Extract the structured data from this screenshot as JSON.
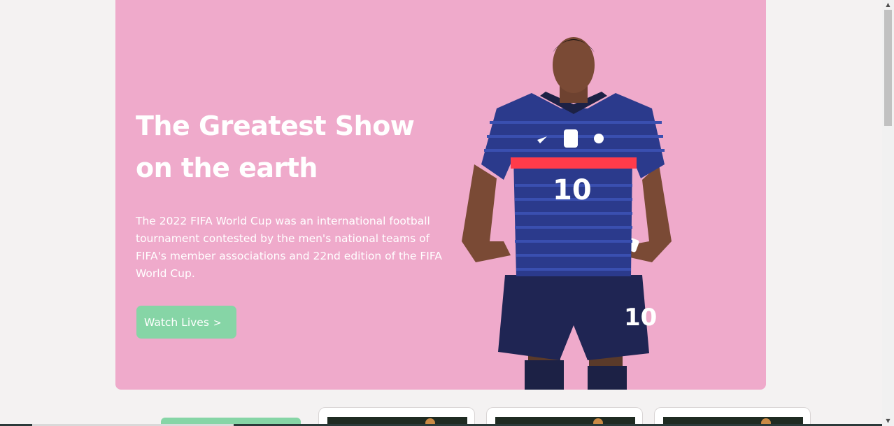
{
  "hero": {
    "title_line1": "The Greatest Show",
    "title_line2": "on the earth",
    "description": "The 2022 FIFA World Cup was an international football tournament contested by the men's national teams of FIFA's member associations and 22nd edition of the FIFA World Cup.",
    "cta_label": "Watch Lives",
    "cta_icon": "chevron-right-icon",
    "jersey_number": "10",
    "colors": {
      "background": "#efaacb",
      "button": "#86d5a6",
      "jersey": "#2b3a8c",
      "jersey_stripe": "#ff3b4a"
    }
  }
}
